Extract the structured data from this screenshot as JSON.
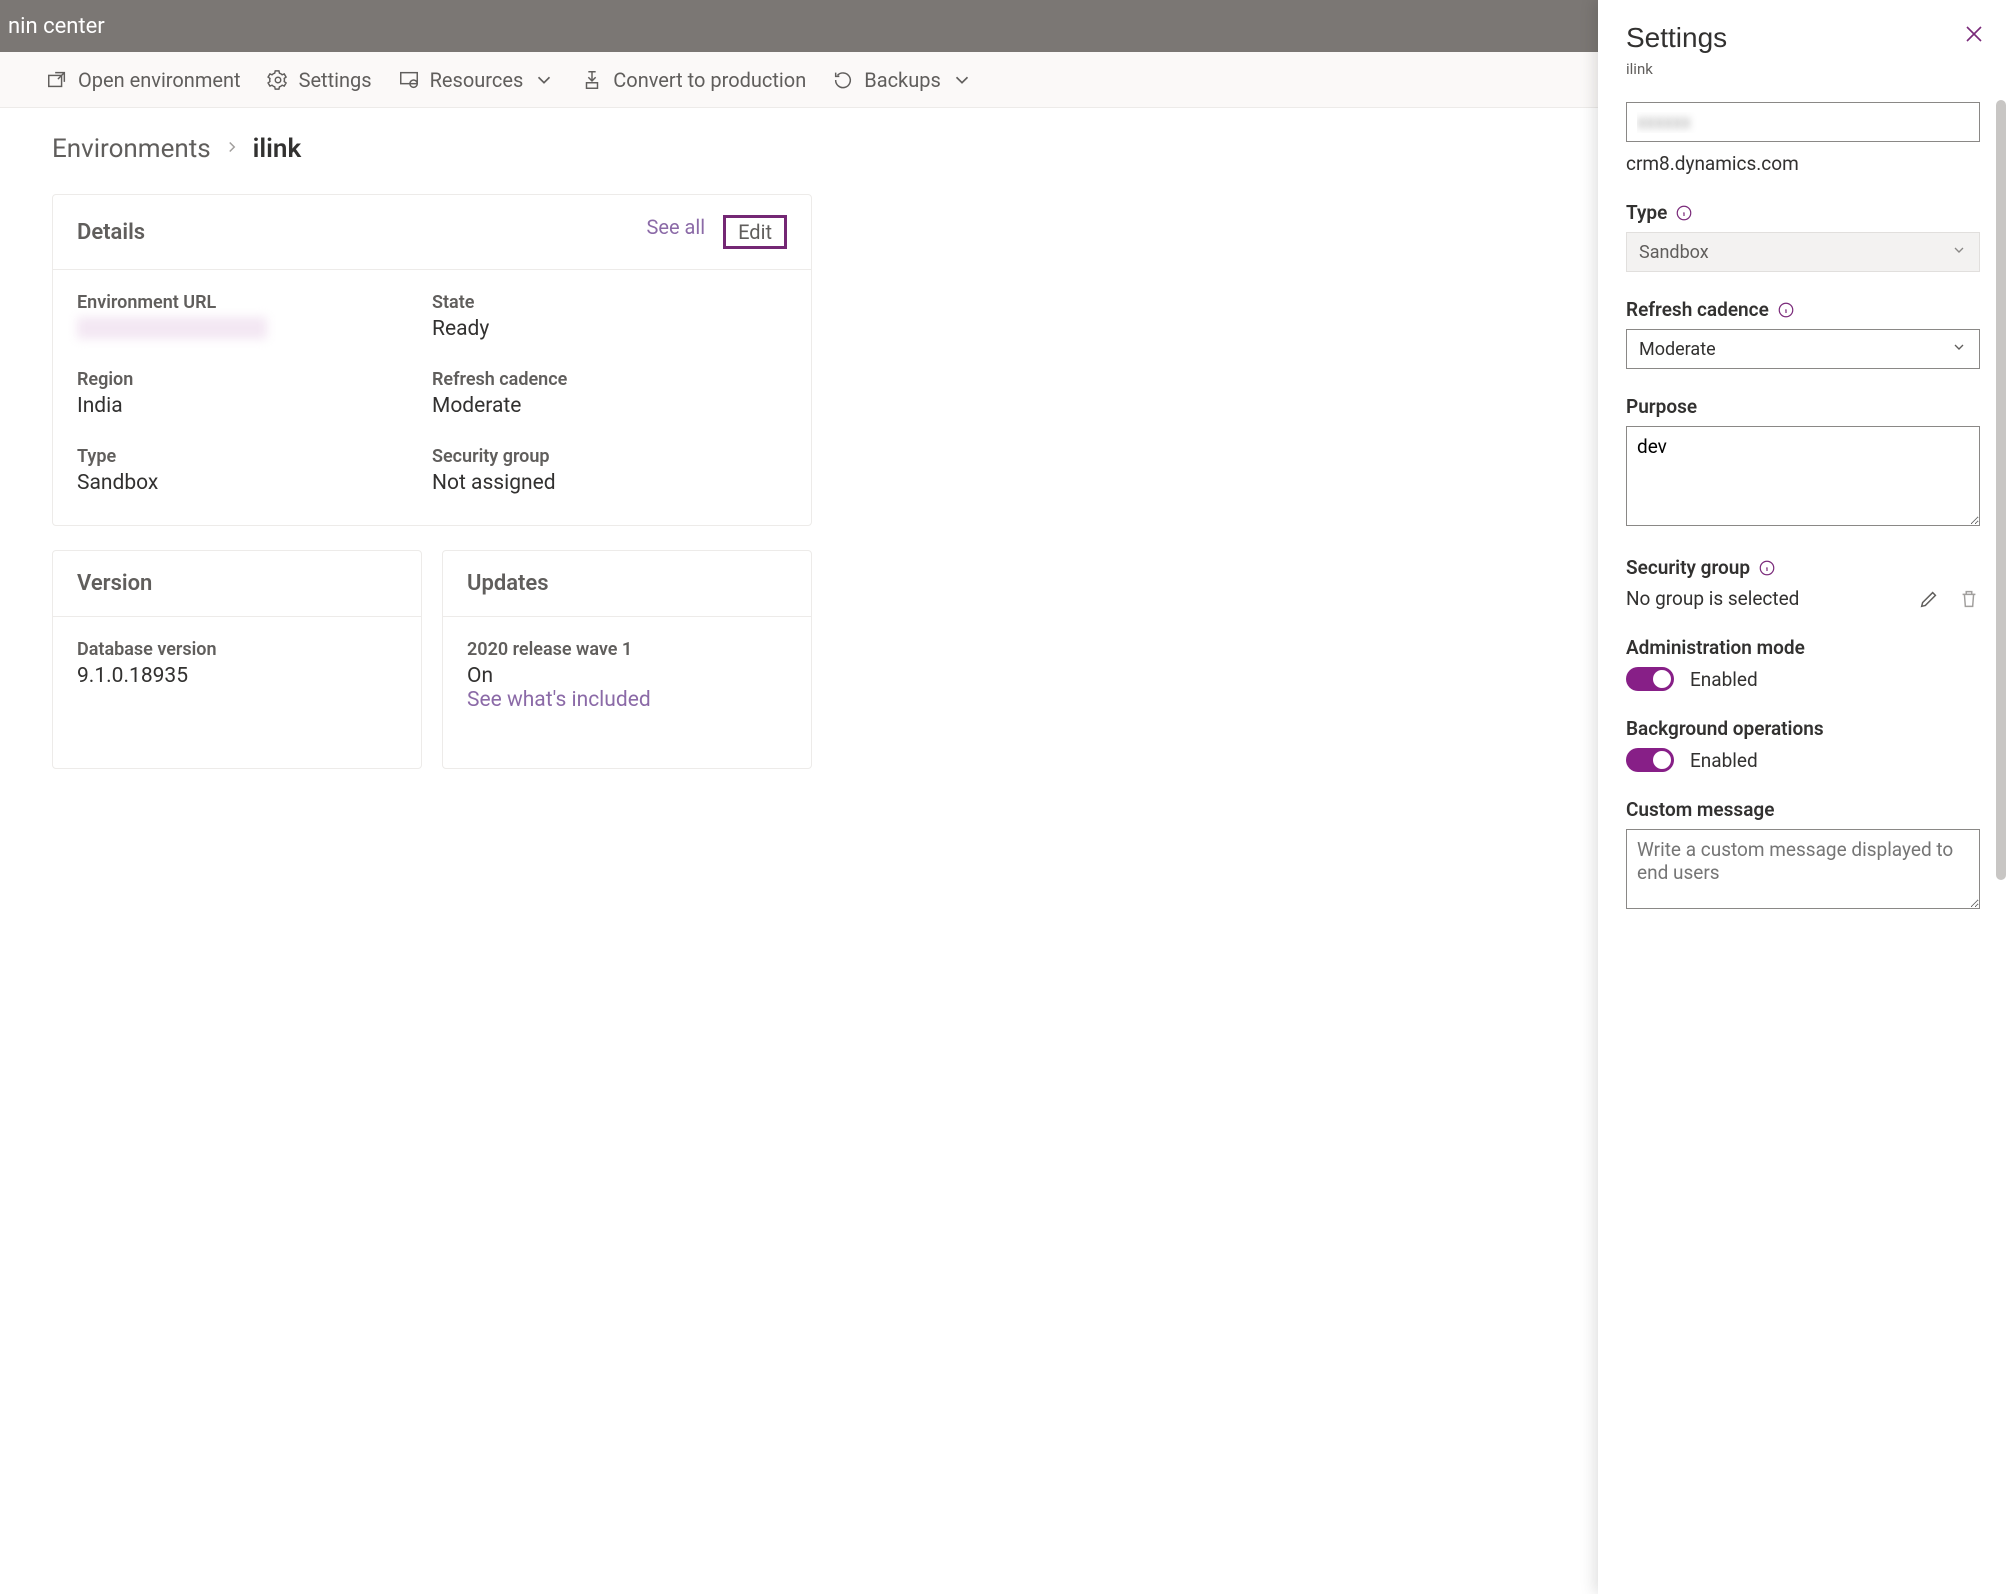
{
  "appbar": {
    "title": "nin center"
  },
  "commandbar": {
    "open_env": "Open environment",
    "settings": "Settings",
    "resources": "Resources",
    "convert": "Convert to production",
    "backups": "Backups"
  },
  "breadcrumb": {
    "root": "Environments",
    "current": "ilink"
  },
  "details_card": {
    "title": "Details",
    "see_all": "See all",
    "edit": "Edit",
    "env_url_label": "Environment URL",
    "state_label": "State",
    "state": "Ready",
    "region_label": "Region",
    "region": "India",
    "refresh_label": "Refresh cadence",
    "refresh": "Moderate",
    "type_label": "Type",
    "type": "Sandbox",
    "secgrp_label": "Security group",
    "secgrp": "Not assigned"
  },
  "version_card": {
    "title": "Version",
    "db_label": "Database version",
    "db_value": "9.1.0.18935"
  },
  "updates_card": {
    "title": "Updates",
    "wave_label": "2020 release wave 1",
    "wave_value": "On",
    "link": "See what's included"
  },
  "panel": {
    "title": "Settings",
    "subtitle": "ilink",
    "url_suffix": "crm8.dynamics.com",
    "type_label": "Type",
    "type_value": "Sandbox",
    "refresh_label": "Refresh cadence",
    "refresh_value": "Moderate",
    "purpose_label": "Purpose",
    "purpose_value": "dev",
    "secgrp_label": "Security group",
    "secgrp_value": "No group is selected",
    "admin_label": "Administration mode",
    "admin_value": "Enabled",
    "bgops_label": "Background operations",
    "bgops_value": "Enabled",
    "custom_label": "Custom message",
    "custom_placeholder": "Write a custom message displayed to end users"
  }
}
